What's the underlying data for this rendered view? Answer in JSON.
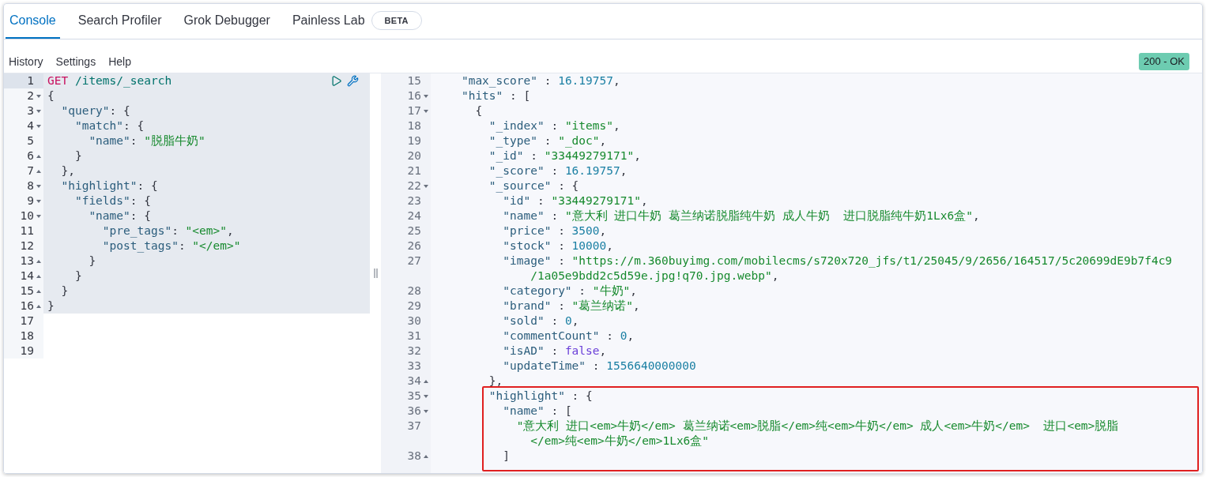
{
  "tabs": [
    {
      "label": "Console",
      "selected": true
    },
    {
      "label": "Search Profiler",
      "selected": false
    },
    {
      "label": "Grok Debugger",
      "selected": false
    },
    {
      "label": "Painless Lab",
      "selected": false,
      "badge": "BETA"
    }
  ],
  "menu": [
    "History",
    "Settings",
    "Help"
  ],
  "status": {
    "text": "200 - OK"
  },
  "request": {
    "lines": [
      {
        "num": "1",
        "kind": "plain",
        "selected": true,
        "cursor": true,
        "tokens": [
          {
            "kind": "method",
            "text": "GET"
          },
          {
            "kind": "url",
            "text": " /items/_search"
          }
        ]
      },
      {
        "num": "2",
        "kind": "open",
        "selected": true,
        "cursor": false,
        "tokens": [
          {
            "kind": "punct",
            "text": "{"
          }
        ]
      },
      {
        "num": "3",
        "kind": "open",
        "selected": true,
        "cursor": false,
        "tokens": [
          {
            "kind": "key",
            "text": "  \"query\""
          },
          {
            "kind": "punct",
            "text": ": {"
          }
        ]
      },
      {
        "num": "4",
        "kind": "open",
        "selected": true,
        "cursor": false,
        "tokens": [
          {
            "kind": "key",
            "text": "    \"match\""
          },
          {
            "kind": "punct",
            "text": ": {"
          }
        ]
      },
      {
        "num": "5",
        "kind": "plain",
        "selected": true,
        "cursor": false,
        "tokens": [
          {
            "kind": "key",
            "text": "      \"name\""
          },
          {
            "kind": "punct",
            "text": ": "
          },
          {
            "kind": "string",
            "text": "\"脱脂牛奶\""
          }
        ]
      },
      {
        "num": "6",
        "kind": "close",
        "selected": true,
        "cursor": false,
        "tokens": [
          {
            "kind": "punct",
            "text": "    }"
          }
        ]
      },
      {
        "num": "7",
        "kind": "close",
        "selected": true,
        "cursor": false,
        "tokens": [
          {
            "kind": "punct",
            "text": "  },"
          }
        ]
      },
      {
        "num": "8",
        "kind": "open",
        "selected": true,
        "cursor": false,
        "tokens": [
          {
            "kind": "key",
            "text": "  \"highlight\""
          },
          {
            "kind": "punct",
            "text": ": {"
          }
        ]
      },
      {
        "num": "9",
        "kind": "open",
        "selected": true,
        "cursor": false,
        "tokens": [
          {
            "kind": "key",
            "text": "    \"fields\""
          },
          {
            "kind": "punct",
            "text": ": {"
          }
        ]
      },
      {
        "num": "10",
        "kind": "open",
        "selected": true,
        "cursor": false,
        "tokens": [
          {
            "kind": "key",
            "text": "      \"name\""
          },
          {
            "kind": "punct",
            "text": ": {"
          }
        ]
      },
      {
        "num": "11",
        "kind": "plain",
        "selected": true,
        "cursor": false,
        "tokens": [
          {
            "kind": "key",
            "text": "        \"pre_tags\""
          },
          {
            "kind": "punct",
            "text": ": "
          },
          {
            "kind": "string",
            "text": "\"<em>\""
          },
          {
            "kind": "punct",
            "text": ","
          }
        ]
      },
      {
        "num": "12",
        "kind": "plain",
        "selected": true,
        "cursor": false,
        "tokens": [
          {
            "kind": "key",
            "text": "        \"post_tags\""
          },
          {
            "kind": "punct",
            "text": ": "
          },
          {
            "kind": "string",
            "text": "\"</em>\""
          }
        ]
      },
      {
        "num": "13",
        "kind": "close",
        "selected": true,
        "cursor": false,
        "tokens": [
          {
            "kind": "punct",
            "text": "      }"
          }
        ]
      },
      {
        "num": "14",
        "kind": "close",
        "selected": true,
        "cursor": false,
        "tokens": [
          {
            "kind": "punct",
            "text": "    }"
          }
        ]
      },
      {
        "num": "15",
        "kind": "close",
        "selected": true,
        "cursor": false,
        "tokens": [
          {
            "kind": "punct",
            "text": "  }"
          }
        ]
      },
      {
        "num": "16",
        "kind": "close",
        "selected": true,
        "cursor": false,
        "tokens": [
          {
            "kind": "punct",
            "text": "}"
          }
        ]
      },
      {
        "num": "17",
        "kind": "plain",
        "selected": false,
        "cursor": false
      },
      {
        "num": "18",
        "kind": "plain",
        "selected": false,
        "cursor": false
      },
      {
        "num": "19",
        "kind": "plain",
        "selected": false,
        "cursor": false
      }
    ]
  },
  "response": {
    "lines": [
      {
        "num": "15",
        "kind": "plain",
        "tokens": [
          {
            "kind": "key",
            "text": "    \"max_score\""
          },
          {
            "kind": "punct",
            "text": " : "
          },
          {
            "kind": "number",
            "text": "16.19757"
          },
          {
            "kind": "punct",
            "text": ","
          }
        ]
      },
      {
        "num": "16",
        "kind": "open",
        "tokens": [
          {
            "kind": "key",
            "text": "    \"hits\""
          },
          {
            "kind": "punct",
            "text": " : ["
          }
        ]
      },
      {
        "num": "17",
        "kind": "open",
        "tokens": [
          {
            "kind": "punct",
            "text": "      {"
          }
        ]
      },
      {
        "num": "18",
        "kind": "plain",
        "tokens": [
          {
            "kind": "key",
            "text": "        \"_index\""
          },
          {
            "kind": "punct",
            "text": " : "
          },
          {
            "kind": "string",
            "text": "\"items\""
          },
          {
            "kind": "punct",
            "text": ","
          }
        ]
      },
      {
        "num": "19",
        "kind": "plain",
        "tokens": [
          {
            "kind": "key",
            "text": "        \"_type\""
          },
          {
            "kind": "punct",
            "text": " : "
          },
          {
            "kind": "string",
            "text": "\"_doc\""
          },
          {
            "kind": "punct",
            "text": ","
          }
        ]
      },
      {
        "num": "20",
        "kind": "plain",
        "tokens": [
          {
            "kind": "key",
            "text": "        \"_id\""
          },
          {
            "kind": "punct",
            "text": " : "
          },
          {
            "kind": "string",
            "text": "\"33449279171\""
          },
          {
            "kind": "punct",
            "text": ","
          }
        ]
      },
      {
        "num": "21",
        "kind": "plain",
        "tokens": [
          {
            "kind": "key",
            "text": "        \"_score\""
          },
          {
            "kind": "punct",
            "text": " : "
          },
          {
            "kind": "number",
            "text": "16.19757"
          },
          {
            "kind": "punct",
            "text": ","
          }
        ]
      },
      {
        "num": "22",
        "kind": "open",
        "tokens": [
          {
            "kind": "key",
            "text": "        \"_source\""
          },
          {
            "kind": "punct",
            "text": " : {"
          }
        ]
      },
      {
        "num": "23",
        "kind": "plain",
        "tokens": [
          {
            "kind": "key",
            "text": "          \"id\""
          },
          {
            "kind": "punct",
            "text": " : "
          },
          {
            "kind": "string",
            "text": "\"33449279171\""
          },
          {
            "kind": "punct",
            "text": ","
          }
        ]
      },
      {
        "num": "24",
        "kind": "plain",
        "tokens": [
          {
            "kind": "key",
            "text": "          \"name\""
          },
          {
            "kind": "punct",
            "text": " : "
          },
          {
            "kind": "string",
            "text": "\"意大利 进口牛奶 葛兰纳诺脱脂纯牛奶 成人牛奶  进口脱脂纯牛奶1Lx6盒\""
          },
          {
            "kind": "punct",
            "text": ","
          }
        ]
      },
      {
        "num": "25",
        "kind": "plain",
        "tokens": [
          {
            "kind": "key",
            "text": "          \"price\""
          },
          {
            "kind": "punct",
            "text": " : "
          },
          {
            "kind": "number",
            "text": "3500"
          },
          {
            "kind": "punct",
            "text": ","
          }
        ]
      },
      {
        "num": "26",
        "kind": "plain",
        "tokens": [
          {
            "kind": "key",
            "text": "          \"stock\""
          },
          {
            "kind": "punct",
            "text": " : "
          },
          {
            "kind": "number",
            "text": "10000"
          },
          {
            "kind": "punct",
            "text": ","
          }
        ]
      },
      {
        "num": "27",
        "kind": "plain",
        "tokens": [
          {
            "kind": "key",
            "text": "          \"image\""
          },
          {
            "kind": "punct",
            "text": " : "
          },
          {
            "kind": "string",
            "text": "\"https://m.360buyimg.com/mobilecms/s720x720_jfs/t1/25045/9/2656/164517/5c20699dE9b7f4c9"
          }
        ],
        "wrap": [
          {
            "kind": "string",
            "text": "              /1a05e9bdd2c5d59e.jpg!q70.jpg.webp\""
          },
          {
            "kind": "punct",
            "text": ","
          }
        ]
      },
      {
        "num": "28",
        "kind": "plain",
        "tokens": [
          {
            "kind": "key",
            "text": "          \"category\""
          },
          {
            "kind": "punct",
            "text": " : "
          },
          {
            "kind": "string",
            "text": "\"牛奶\""
          },
          {
            "kind": "punct",
            "text": ","
          }
        ]
      },
      {
        "num": "29",
        "kind": "plain",
        "tokens": [
          {
            "kind": "key",
            "text": "          \"brand\""
          },
          {
            "kind": "punct",
            "text": " : "
          },
          {
            "kind": "string",
            "text": "\"葛兰纳诺\""
          },
          {
            "kind": "punct",
            "text": ","
          }
        ]
      },
      {
        "num": "30",
        "kind": "plain",
        "tokens": [
          {
            "kind": "key",
            "text": "          \"sold\""
          },
          {
            "kind": "punct",
            "text": " : "
          },
          {
            "kind": "number",
            "text": "0"
          },
          {
            "kind": "punct",
            "text": ","
          }
        ]
      },
      {
        "num": "31",
        "kind": "plain",
        "tokens": [
          {
            "kind": "key",
            "text": "          \"commentCount\""
          },
          {
            "kind": "punct",
            "text": " : "
          },
          {
            "kind": "number",
            "text": "0"
          },
          {
            "kind": "punct",
            "text": ","
          }
        ]
      },
      {
        "num": "32",
        "kind": "plain",
        "tokens": [
          {
            "kind": "key",
            "text": "          \"isAD\""
          },
          {
            "kind": "punct",
            "text": " : "
          },
          {
            "kind": "boolean",
            "text": "false"
          },
          {
            "kind": "punct",
            "text": ","
          }
        ]
      },
      {
        "num": "33",
        "kind": "plain",
        "tokens": [
          {
            "kind": "key",
            "text": "          \"updateTime\""
          },
          {
            "kind": "punct",
            "text": " : "
          },
          {
            "kind": "number",
            "text": "1556640000000"
          }
        ]
      },
      {
        "num": "34",
        "kind": "close",
        "tokens": [
          {
            "kind": "punct",
            "text": "        },"
          }
        ]
      },
      {
        "num": "35",
        "kind": "open",
        "boxed": true,
        "tokens": [
          {
            "kind": "key",
            "text": "        \"highlight\""
          },
          {
            "kind": "punct",
            "text": " : {"
          }
        ]
      },
      {
        "num": "36",
        "kind": "open",
        "boxed": true,
        "tokens": [
          {
            "kind": "key",
            "text": "          \"name\""
          },
          {
            "kind": "punct",
            "text": " : ["
          }
        ]
      },
      {
        "num": "37",
        "kind": "plain",
        "boxed": true,
        "tokens": [
          {
            "kind": "string",
            "text": "            \"意大利 进口<em>牛奶</em> 葛兰纳诺<em>脱脂</em>纯<em>牛奶</em> 成人<em>牛奶</em>  进口<em>脱脂"
          }
        ],
        "wrap": [
          {
            "kind": "string",
            "text": "              </em>纯<em>牛奶</em>1Lx6盒\""
          }
        ]
      },
      {
        "num": "38",
        "kind": "close",
        "boxed": true,
        "tokens": [
          {
            "kind": "punct",
            "text": "          ]"
          }
        ]
      }
    ]
  }
}
